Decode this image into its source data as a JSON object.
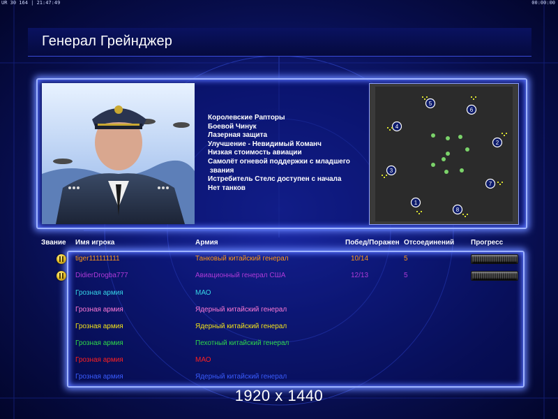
{
  "status_bar": {
    "left_text": "UR 30 164 | 21:47:49",
    "right_text": "00:00:00"
  },
  "title": "Генерал Грейнджер",
  "general_features": [
    "Королевские Рапторы",
    "Боевой Чинук",
    "Лазерная защита",
    "Улучшение - Невидимый Команч",
    "Низкая стоимость авиации",
    "Самолёт огневой поддержки с младшего",
    " звания",
    "Истребитель Стелс доступен с начала",
    "Нет танков"
  ],
  "minimap": {
    "start_positions": [
      "1",
      "2",
      "3",
      "4",
      "5",
      "6",
      "7",
      "8"
    ]
  },
  "table": {
    "headers": {
      "rank": "Звание",
      "player": "Имя игрока",
      "army": "Армия",
      "wins_losses": "Побед/Поражен",
      "disconnects": "Отсоединений",
      "progress": "Прогресс"
    },
    "rows": [
      {
        "name": "tiger111111111",
        "army": "Танковый китайский генерал",
        "wl": "10/14",
        "dc": "5",
        "color": "#ff9a1a",
        "has_rank": true,
        "has_progress": true
      },
      {
        "name": "DidierDrogba777",
        "army": "Авиационный генерал США",
        "wl": "12/13",
        "dc": "5",
        "color": "#b03ad8",
        "has_rank": true,
        "has_progress": true
      },
      {
        "name": "Грозная армия",
        "army": "МАО",
        "wl": "",
        "dc": "",
        "color": "#37d6e6",
        "has_rank": false,
        "has_progress": false
      },
      {
        "name": "Грозная армия",
        "army": "Ядерный китайский генерал",
        "wl": "",
        "dc": "",
        "color": "#ff7ad6",
        "has_rank": false,
        "has_progress": false
      },
      {
        "name": "Грозная армия",
        "army": "Ядерный китайский генерал",
        "wl": "",
        "dc": "",
        "color": "#f2e21a",
        "has_rank": false,
        "has_progress": false
      },
      {
        "name": "Грозная армия",
        "army": "Пехотный китайский генерал",
        "wl": "",
        "dc": "",
        "color": "#2fd84a",
        "has_rank": false,
        "has_progress": false
      },
      {
        "name": "Грозная армия",
        "army": "МАО",
        "wl": "",
        "dc": "",
        "color": "#ff2020",
        "has_rank": false,
        "has_progress": false
      },
      {
        "name": "Грозная армия",
        "army": "Ядерный китайский генерал",
        "wl": "",
        "dc": "",
        "color": "#3a5cff",
        "has_rank": false,
        "has_progress": false
      }
    ]
  },
  "resolution_label": "1920 x 1440"
}
